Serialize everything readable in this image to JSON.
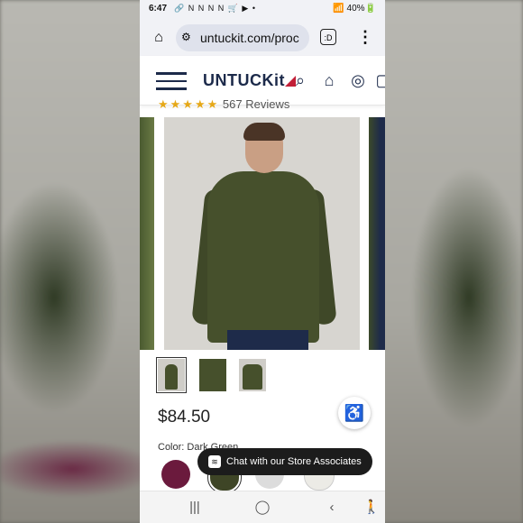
{
  "status_bar": {
    "time": "6:47",
    "notification_icons": "🔗 N N N N 🛒 ▶ •",
    "system_icons": "📶 40%🔋"
  },
  "browser": {
    "url": "untuckit.com/proc",
    "tab_icon": ":D",
    "menu_icon": "⋮"
  },
  "site_header": {
    "logo_text": "UNTUCKit",
    "icons": [
      "search-icon",
      "store-icon",
      "account-icon",
      "bag-icon"
    ]
  },
  "product": {
    "stars": "★★★★★",
    "reviews_text": "567 Reviews",
    "price": "$84.50",
    "color_label": "Color: Dark Green"
  },
  "swatches": [
    "#6b1a3d",
    "#3e4526",
    "#dcdcdc",
    "#ecebe6"
  ],
  "chat": {
    "label": "Chat with our Store Associates"
  },
  "nav_bar": {
    "recents": "|||",
    "home": "◯",
    "back": "‹",
    "accessibility": "🚶"
  }
}
